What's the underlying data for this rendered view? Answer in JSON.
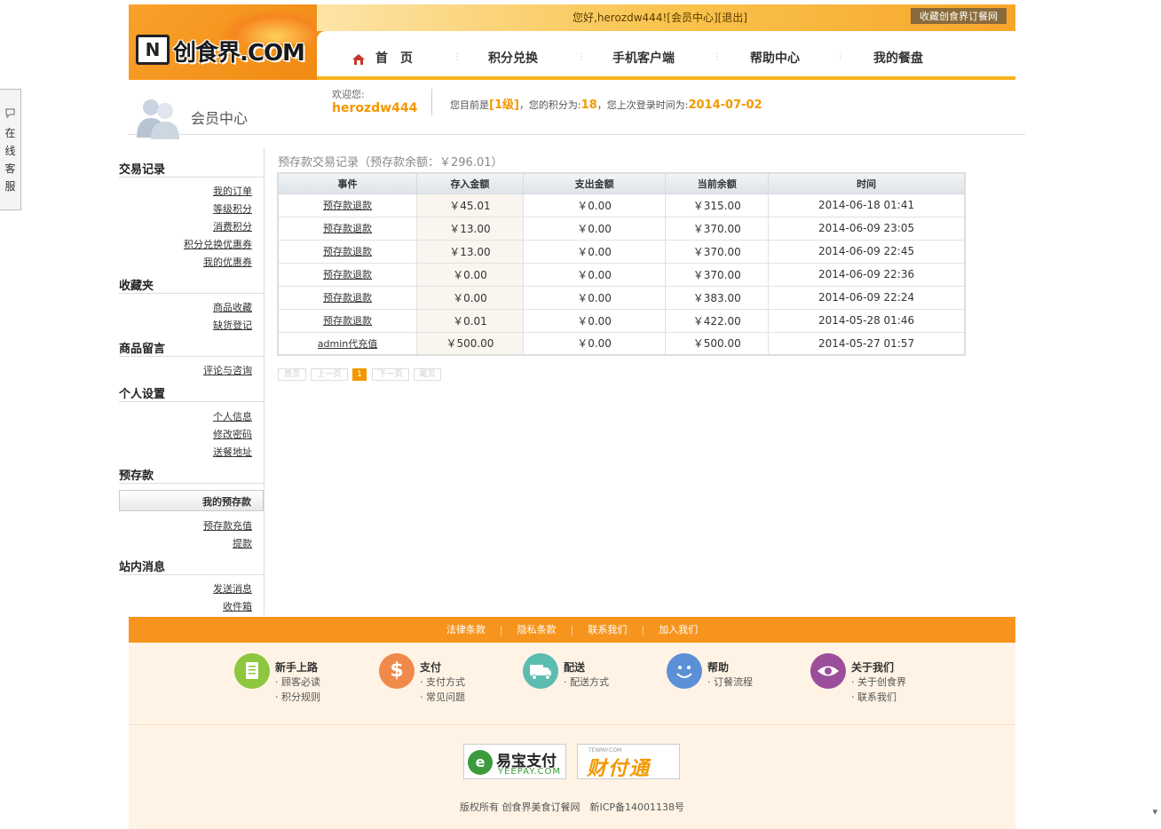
{
  "header": {
    "logo_icon": "N",
    "logo_text": "创食界.COM",
    "greeting": "您好,herozdw444![会员中心][退出]",
    "fav_label": "收藏创食界订餐网",
    "nav": [
      "首　页",
      "积分兑换",
      "手机客户端",
      "帮助中心",
      "我的餐盘"
    ]
  },
  "member": {
    "title": "会员中心",
    "welcome": "欢迎您:",
    "username": "herozdw444",
    "status_prefix": "您目前是",
    "level": "[1级]",
    "status_mid": "，您的积分为:",
    "points": "18",
    "status_mid2": "，您上次登录时间为:",
    "last_login": "2014-07-02"
  },
  "kefu": [
    "在",
    "线",
    "客",
    "服"
  ],
  "sidebar": {
    "sections": [
      {
        "title": "交易记录",
        "links": [
          "我的订单",
          "等级积分",
          "消费积分",
          "积分兑换优惠券",
          "我的优惠券"
        ]
      },
      {
        "title": "收藏夹",
        "links": [
          "商品收藏",
          "缺货登记"
        ]
      },
      {
        "title": "商品留言",
        "links": [
          "评论与咨询"
        ]
      },
      {
        "title": "个人设置",
        "links": [
          "个人信息",
          "修改密码",
          "送餐地址"
        ]
      },
      {
        "title": "预存款",
        "active": "我的预存款",
        "links": [
          "预存款充值",
          "提款"
        ]
      },
      {
        "title": "站内消息",
        "links": [
          "发送消息",
          "收件箱"
        ]
      }
    ]
  },
  "main": {
    "title": "预存款交易记录（预存款余额：￥296.01）",
    "columns": [
      "事件",
      "存入金额",
      "支出金额",
      "当前余额",
      "时间"
    ],
    "rows": [
      [
        "预存款退款",
        "￥45.01",
        "￥0.00",
        "￥315.00",
        "2014-06-18 01:41"
      ],
      [
        "预存款退款",
        "￥13.00",
        "￥0.00",
        "￥370.00",
        "2014-06-09 23:05"
      ],
      [
        "预存款退款",
        "￥13.00",
        "￥0.00",
        "￥370.00",
        "2014-06-09 22:45"
      ],
      [
        "预存款退款",
        "￥0.00",
        "￥0.00",
        "￥370.00",
        "2014-06-09 22:36"
      ],
      [
        "预存款退款",
        "￥0.00",
        "￥0.00",
        "￥383.00",
        "2014-06-09 22:24"
      ],
      [
        "预存款退款",
        "￥0.01",
        "￥0.00",
        "￥422.00",
        "2014-05-28 01:46"
      ],
      [
        "admin代充值",
        "￥500.00",
        "￥0.00",
        "￥500.00",
        "2014-05-27 01:57"
      ]
    ],
    "pager": [
      "首页",
      "上一页",
      "1",
      "下一页",
      "尾页"
    ]
  },
  "footer": {
    "links": [
      "法律条款",
      "隐私条款",
      "联系我们",
      "加入我们"
    ],
    "infos": [
      {
        "title": "新手上路",
        "icon": "list-icon",
        "color": "#8dc63f",
        "items": [
          "· 顾客必读",
          "· 积分规则"
        ]
      },
      {
        "title": "支付",
        "icon": "dollar-icon",
        "color": "#f08a4b",
        "items": [
          "· 支付方式",
          "· 常见问题"
        ]
      },
      {
        "title": "配送",
        "icon": "truck-icon",
        "color": "#5bbcb0",
        "items": [
          "· 配送方式"
        ]
      },
      {
        "title": "帮助",
        "icon": "smile-icon",
        "color": "#5b8fd6",
        "items": [
          "· 订餐流程"
        ]
      },
      {
        "title": "关于我们",
        "icon": "eye-icon",
        "color": "#9b4f9b",
        "items": [
          "· 关于创食界",
          "· 联系我们"
        ]
      }
    ],
    "pay1_title": "易宝支付",
    "pay1_sub": "YEEPAY.COM",
    "pay2_small": "TENPAY.COM",
    "pay2_title": "财付通",
    "copyright": "版权所有 创食界美食订餐网　新ICP备14001138号"
  },
  "colors": {
    "accent": "#f7941d",
    "highlight": "#f39800"
  }
}
